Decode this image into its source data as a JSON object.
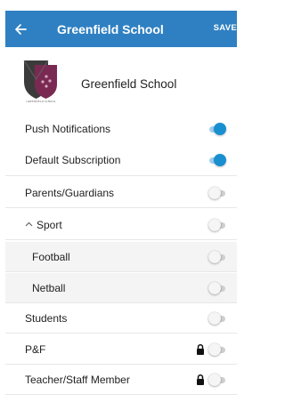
{
  "header": {
    "back_icon": "arrow-left-icon",
    "title": "Greenfield School",
    "save_label": "SAVE",
    "background": "#2f80c2"
  },
  "school": {
    "name": "Greenfield School",
    "logo": "school-crest-logo",
    "logo_caption": "GREENFIELD SCHOOL"
  },
  "settings": [
    {
      "label": "Push Notifications",
      "on": true
    },
    {
      "label": "Default Subscription",
      "on": true
    }
  ],
  "groups": [
    {
      "label": "Parents/Guardians",
      "on": false,
      "locked": false
    },
    {
      "label": "Sport",
      "on": false,
      "expanded": true,
      "expander_icon": "chevron-up-icon",
      "children": [
        {
          "label": "Football",
          "on": false
        },
        {
          "label": "Netball",
          "on": false
        }
      ]
    },
    {
      "label": "Students",
      "on": false,
      "locked": false
    },
    {
      "label": "P&F",
      "on": false,
      "locked": true
    },
    {
      "label": "Teacher/Staff Member",
      "on": false,
      "locked": true
    }
  ],
  "colors": {
    "accent": "#1a8fd0",
    "toggle_off": "#cfcfcf",
    "subgroup_background": "#f4f4f4"
  }
}
